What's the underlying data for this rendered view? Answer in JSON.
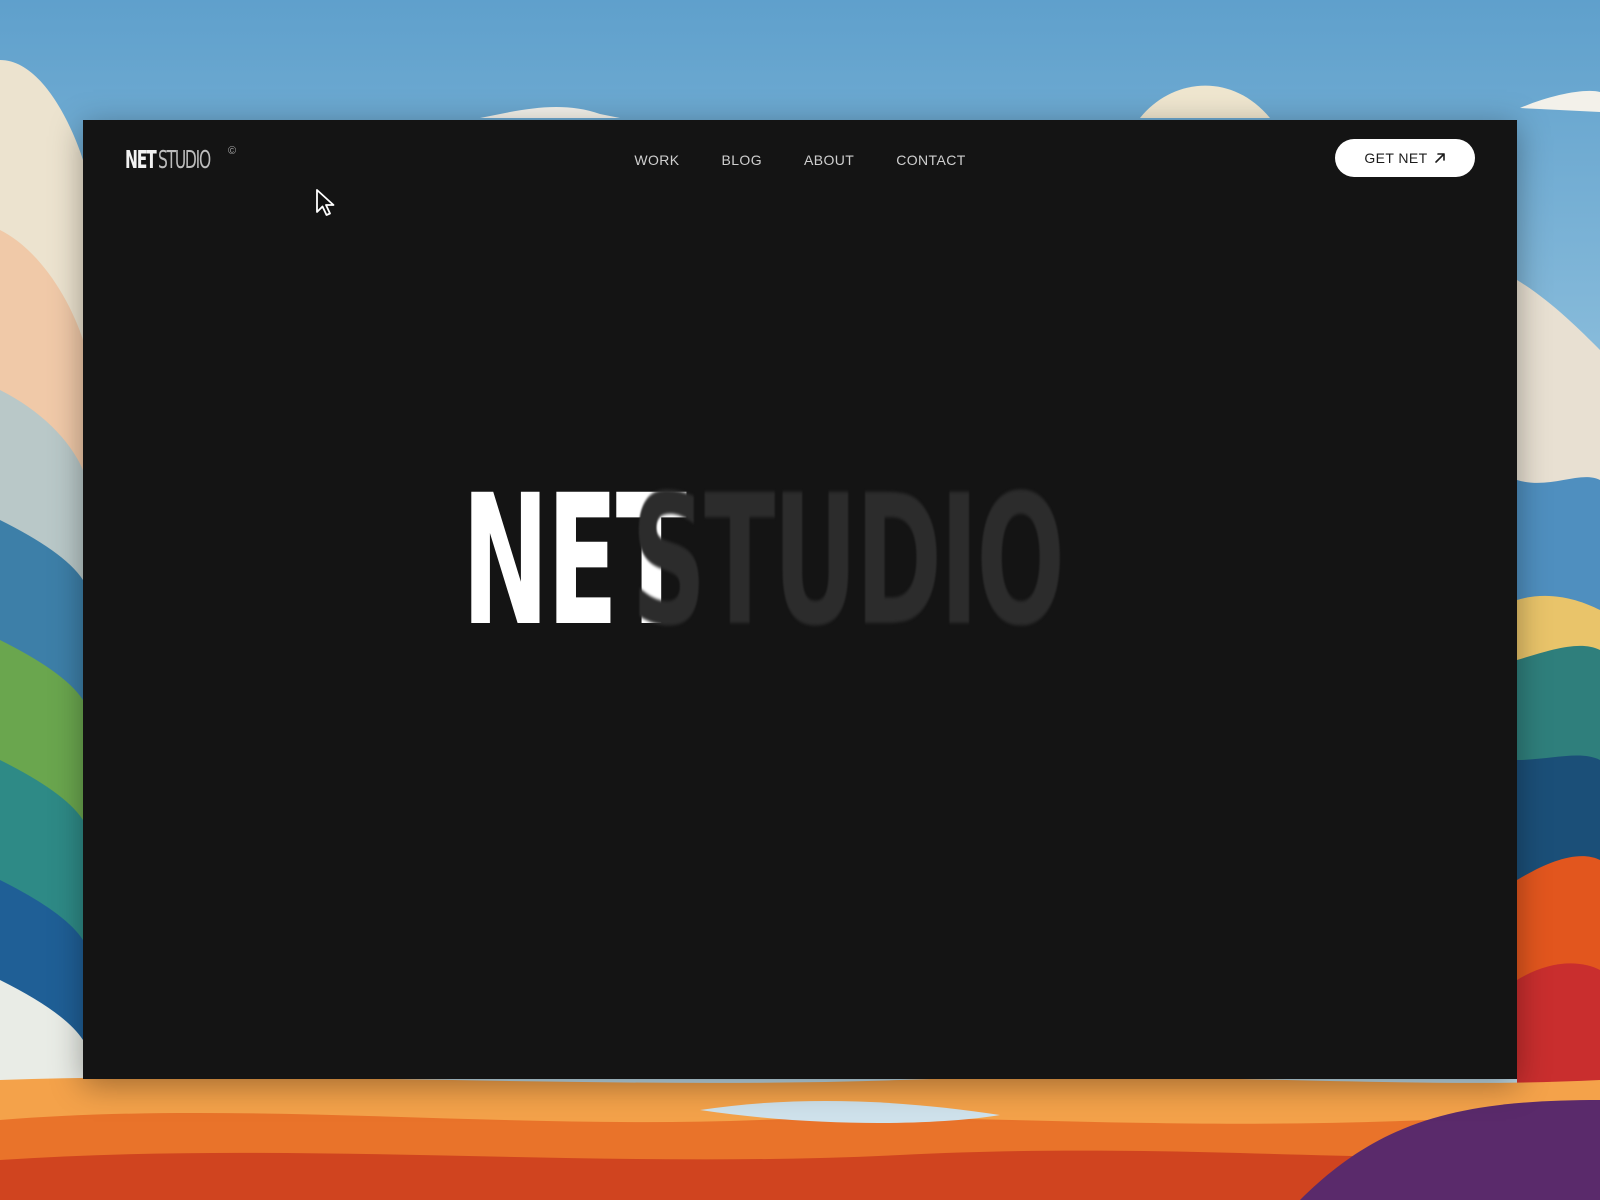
{
  "site": {
    "logo_strong": "NET",
    "logo_light": "STUDIO",
    "logo_mark": "©"
  },
  "nav": {
    "items": [
      {
        "label": "WORK"
      },
      {
        "label": "BLOG"
      },
      {
        "label": "ABOUT"
      },
      {
        "label": "CONTACT"
      }
    ]
  },
  "cta": {
    "label": "GET NET",
    "icon": "arrow-up-right-icon"
  },
  "hero": {
    "word_strong": "NET",
    "word_faded": "STUDIO"
  },
  "colors": {
    "page_background": "#141414",
    "primary_text": "#ffffff",
    "muted_text": "#2c2c2c",
    "cta_background": "#ffffff"
  }
}
